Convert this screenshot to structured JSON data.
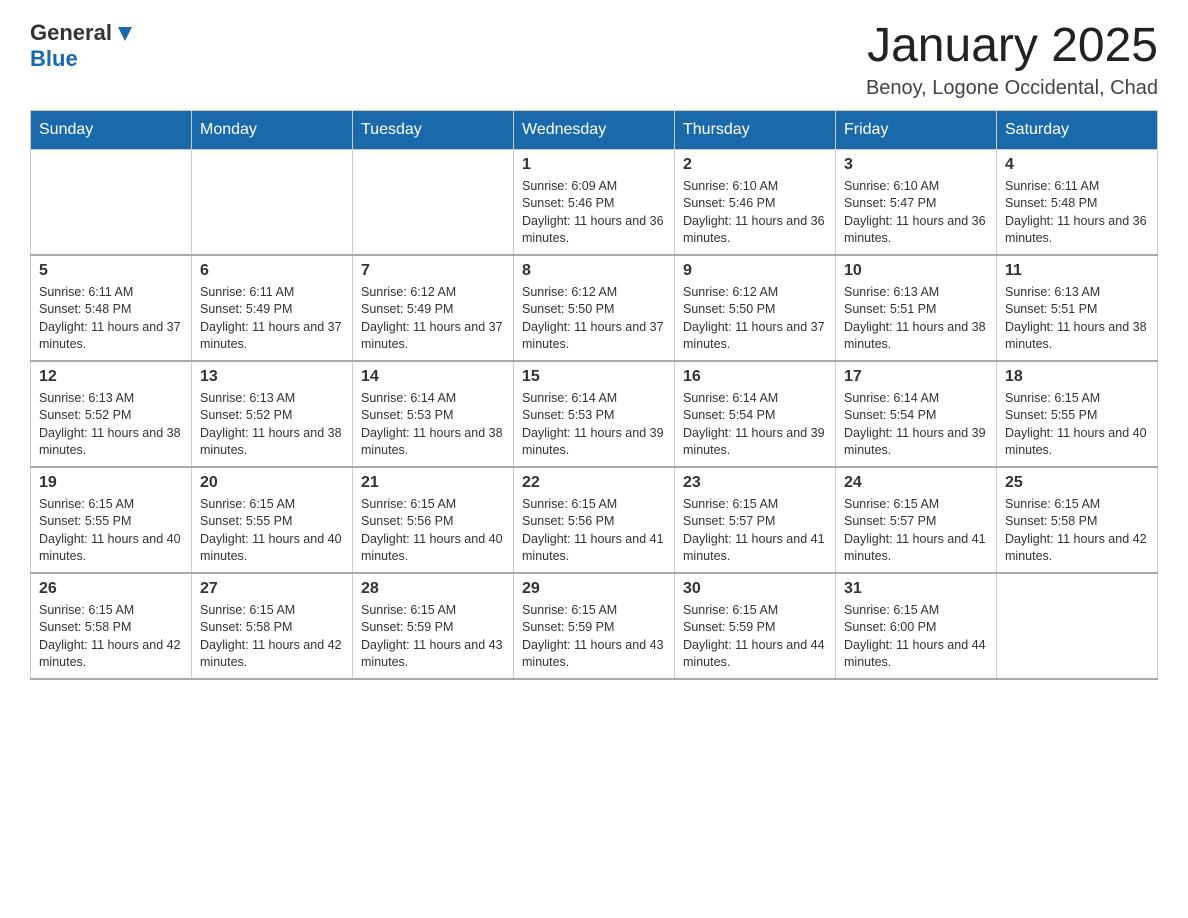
{
  "header": {
    "logo": {
      "general": "General",
      "blue": "Blue"
    },
    "title": "January 2025",
    "subtitle": "Benoy, Logone Occidental, Chad"
  },
  "weekdays": [
    "Sunday",
    "Monday",
    "Tuesday",
    "Wednesday",
    "Thursday",
    "Friday",
    "Saturday"
  ],
  "weeks": [
    [
      {
        "day": "",
        "info": ""
      },
      {
        "day": "",
        "info": ""
      },
      {
        "day": "",
        "info": ""
      },
      {
        "day": "1",
        "info": "Sunrise: 6:09 AM\nSunset: 5:46 PM\nDaylight: 11 hours and 36 minutes."
      },
      {
        "day": "2",
        "info": "Sunrise: 6:10 AM\nSunset: 5:46 PM\nDaylight: 11 hours and 36 minutes."
      },
      {
        "day": "3",
        "info": "Sunrise: 6:10 AM\nSunset: 5:47 PM\nDaylight: 11 hours and 36 minutes."
      },
      {
        "day": "4",
        "info": "Sunrise: 6:11 AM\nSunset: 5:48 PM\nDaylight: 11 hours and 36 minutes."
      }
    ],
    [
      {
        "day": "5",
        "info": "Sunrise: 6:11 AM\nSunset: 5:48 PM\nDaylight: 11 hours and 37 minutes."
      },
      {
        "day": "6",
        "info": "Sunrise: 6:11 AM\nSunset: 5:49 PM\nDaylight: 11 hours and 37 minutes."
      },
      {
        "day": "7",
        "info": "Sunrise: 6:12 AM\nSunset: 5:49 PM\nDaylight: 11 hours and 37 minutes."
      },
      {
        "day": "8",
        "info": "Sunrise: 6:12 AM\nSunset: 5:50 PM\nDaylight: 11 hours and 37 minutes."
      },
      {
        "day": "9",
        "info": "Sunrise: 6:12 AM\nSunset: 5:50 PM\nDaylight: 11 hours and 37 minutes."
      },
      {
        "day": "10",
        "info": "Sunrise: 6:13 AM\nSunset: 5:51 PM\nDaylight: 11 hours and 38 minutes."
      },
      {
        "day": "11",
        "info": "Sunrise: 6:13 AM\nSunset: 5:51 PM\nDaylight: 11 hours and 38 minutes."
      }
    ],
    [
      {
        "day": "12",
        "info": "Sunrise: 6:13 AM\nSunset: 5:52 PM\nDaylight: 11 hours and 38 minutes."
      },
      {
        "day": "13",
        "info": "Sunrise: 6:13 AM\nSunset: 5:52 PM\nDaylight: 11 hours and 38 minutes."
      },
      {
        "day": "14",
        "info": "Sunrise: 6:14 AM\nSunset: 5:53 PM\nDaylight: 11 hours and 38 minutes."
      },
      {
        "day": "15",
        "info": "Sunrise: 6:14 AM\nSunset: 5:53 PM\nDaylight: 11 hours and 39 minutes."
      },
      {
        "day": "16",
        "info": "Sunrise: 6:14 AM\nSunset: 5:54 PM\nDaylight: 11 hours and 39 minutes."
      },
      {
        "day": "17",
        "info": "Sunrise: 6:14 AM\nSunset: 5:54 PM\nDaylight: 11 hours and 39 minutes."
      },
      {
        "day": "18",
        "info": "Sunrise: 6:15 AM\nSunset: 5:55 PM\nDaylight: 11 hours and 40 minutes."
      }
    ],
    [
      {
        "day": "19",
        "info": "Sunrise: 6:15 AM\nSunset: 5:55 PM\nDaylight: 11 hours and 40 minutes."
      },
      {
        "day": "20",
        "info": "Sunrise: 6:15 AM\nSunset: 5:55 PM\nDaylight: 11 hours and 40 minutes."
      },
      {
        "day": "21",
        "info": "Sunrise: 6:15 AM\nSunset: 5:56 PM\nDaylight: 11 hours and 40 minutes."
      },
      {
        "day": "22",
        "info": "Sunrise: 6:15 AM\nSunset: 5:56 PM\nDaylight: 11 hours and 41 minutes."
      },
      {
        "day": "23",
        "info": "Sunrise: 6:15 AM\nSunset: 5:57 PM\nDaylight: 11 hours and 41 minutes."
      },
      {
        "day": "24",
        "info": "Sunrise: 6:15 AM\nSunset: 5:57 PM\nDaylight: 11 hours and 41 minutes."
      },
      {
        "day": "25",
        "info": "Sunrise: 6:15 AM\nSunset: 5:58 PM\nDaylight: 11 hours and 42 minutes."
      }
    ],
    [
      {
        "day": "26",
        "info": "Sunrise: 6:15 AM\nSunset: 5:58 PM\nDaylight: 11 hours and 42 minutes."
      },
      {
        "day": "27",
        "info": "Sunrise: 6:15 AM\nSunset: 5:58 PM\nDaylight: 11 hours and 42 minutes."
      },
      {
        "day": "28",
        "info": "Sunrise: 6:15 AM\nSunset: 5:59 PM\nDaylight: 11 hours and 43 minutes."
      },
      {
        "day": "29",
        "info": "Sunrise: 6:15 AM\nSunset: 5:59 PM\nDaylight: 11 hours and 43 minutes."
      },
      {
        "day": "30",
        "info": "Sunrise: 6:15 AM\nSunset: 5:59 PM\nDaylight: 11 hours and 44 minutes."
      },
      {
        "day": "31",
        "info": "Sunrise: 6:15 AM\nSunset: 6:00 PM\nDaylight: 11 hours and 44 minutes."
      },
      {
        "day": "",
        "info": ""
      }
    ]
  ]
}
